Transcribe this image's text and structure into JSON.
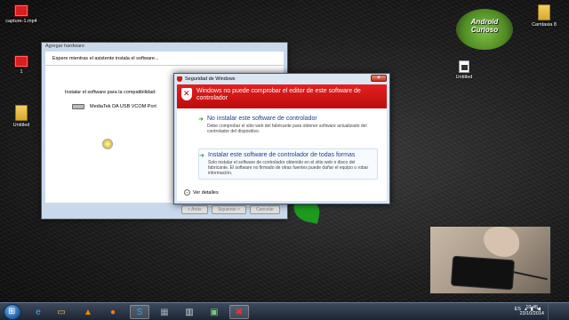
{
  "desktop": {
    "icons": [
      {
        "label": "capture-1.mp4"
      },
      {
        "label": "1"
      },
      {
        "label": "Untitled"
      },
      {
        "label": "Camtasia 8"
      },
      {
        "label": "Untitled"
      }
    ],
    "logo_text": "Android Curioso"
  },
  "add_hardware": {
    "title": "Agregar hardware",
    "header": "Espere mientras el asistente instala el software...",
    "installing_label": "Instalar el software para la compatibilidad:",
    "device_name": "MediaTek DA USB VCOM Port",
    "buttons": {
      "back": "< Atrás",
      "next": "Siguiente >",
      "cancel": "Cancelar"
    }
  },
  "security_dialog": {
    "title": "Seguridad de Windows",
    "banner": "Windows no puede comprobar el editor de este software de controlador",
    "option1": {
      "title": "No instalar este software de controlador",
      "desc": "Debe comprobar el sitio web del fabricante para obtener software actualizado del controlador del dispositivo."
    },
    "option2": {
      "title": "Instalar este software de controlador de todas formas",
      "desc": "Solo instalar el software de controlador obtenido en el sitio web o disco del fabricante. El software no firmado de otras fuentes puede dañar el equipo o robar información."
    },
    "details": "Ver detalles",
    "colors": {
      "banner": "#d01414",
      "option_title": "#1d3f8e",
      "arrow": "#1a9a1a"
    }
  },
  "taskbar": {
    "items": [
      "start-orb",
      "ie-icon",
      "explorer-icon",
      "vlc-icon",
      "firefox-icon",
      "skype-icon",
      "app-icon",
      "app-icon",
      "app-icon",
      "app-icon",
      "close-app-icon"
    ],
    "language": "ES",
    "time": "10:45",
    "date": "23/10/2014"
  }
}
